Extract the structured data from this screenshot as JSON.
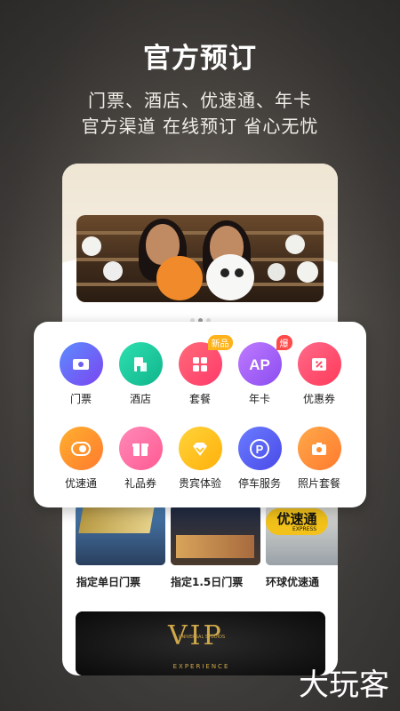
{
  "headline": "官方预订",
  "subtitle_line1": "门票、酒店、优速通、年卡",
  "subtitle_line2": "官方渠道 在线预订 省心无忧",
  "menu": {
    "row1": [
      {
        "label": "门票",
        "icon": "ticket-icon",
        "color": "#6d5cf2"
      },
      {
        "label": "酒店",
        "icon": "hotel-icon",
        "color": "#18c6a1"
      },
      {
        "label": "套餐",
        "icon": "package-icon",
        "color": "#ff4d76",
        "badge": "新品"
      },
      {
        "label": "年卡",
        "icon": "annual-pass-icon",
        "color": "#9b5cf6",
        "badge": "爆"
      },
      {
        "label": "优惠券",
        "icon": "coupon-icon",
        "color": "#ff4d6a"
      }
    ],
    "row2": [
      {
        "label": "优速通",
        "icon": "express-pass-icon",
        "color": "#ff9a2e"
      },
      {
        "label": "礼品券",
        "icon": "gift-icon",
        "color": "#ff6aa2"
      },
      {
        "label": "贵宾体验",
        "icon": "vip-diamond-icon",
        "color": "#ffc21a"
      },
      {
        "label": "停车服务",
        "icon": "parking-icon",
        "color": "#5a5ff0"
      },
      {
        "label": "照片套餐",
        "icon": "camera-icon",
        "color": "#ff8c2e"
      }
    ]
  },
  "products": [
    {
      "label": "指定单日门票"
    },
    {
      "label": "指定1.5日门票"
    },
    {
      "label": "环球优速通",
      "sign_text": "优速通",
      "sign_sub": "EXPRESS"
    }
  ],
  "vip_banner": {
    "text": "VIP",
    "brand": "UNIVERSAL STUDIOS",
    "caption": "EXPERIENCE"
  },
  "watermark": "大玩客"
}
